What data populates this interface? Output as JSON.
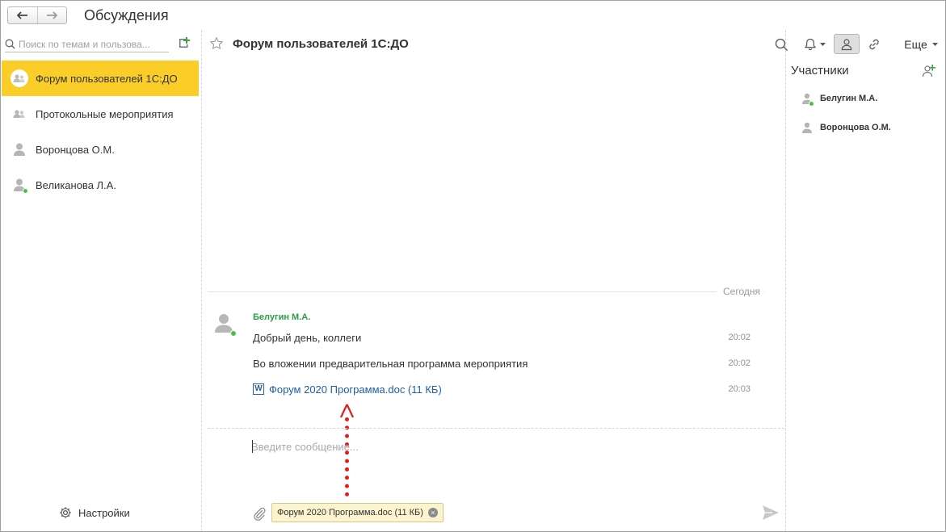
{
  "window": {
    "title": "Обсуждения"
  },
  "search": {
    "placeholder": "Поиск по темам и пользова..."
  },
  "conversations": [
    {
      "label": "Форум пользователей 1С:ДО",
      "type": "group",
      "active": true
    },
    {
      "label": "Протокольные мероприятия",
      "type": "group",
      "active": false
    },
    {
      "label": "Воронцова О.М.",
      "type": "user",
      "active": false,
      "online": false
    },
    {
      "label": "Великанова Л.А.",
      "type": "user",
      "active": false,
      "online": true
    }
  ],
  "settings": {
    "label": "Настройки"
  },
  "chat": {
    "title": "Форум пользователей 1С:ДО",
    "more_label": "Еще",
    "day_label": "Сегодня",
    "author": "Белугин М.А.",
    "messages": [
      {
        "text": "Добрый день, коллеги",
        "time": "20:02"
      },
      {
        "text": "Во вложении предварительная программа мероприятия",
        "time": "20:02"
      }
    ],
    "file_message": {
      "text": "Форум 2020 Программа.doc (11 КБ)",
      "time": "20:03"
    },
    "input_placeholder": "Введите сообщение...",
    "attachment_chip": "Форум 2020 Программа.doc (11 КБ)"
  },
  "participants": {
    "title": "Участники",
    "members": [
      {
        "name": "Белугин М.А.",
        "online": true
      },
      {
        "name": "Воронцова О.М.",
        "online": false
      }
    ]
  },
  "colors": {
    "active_item": "#fbcd28",
    "author": "#2a9a44",
    "link": "#1e5ea8",
    "online": "#45c24b",
    "annotation_arrow": "#e21b1b",
    "chip_bg": "#fbf4cf"
  }
}
